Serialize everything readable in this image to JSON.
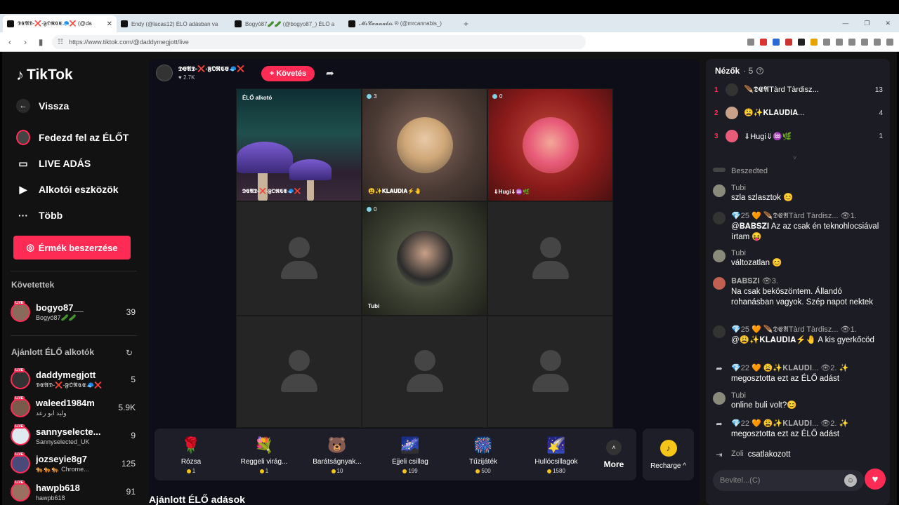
{
  "browser": {
    "tabs": [
      {
        "title": "𝕯𝕰𝕬𝕯-❌-𝕱𝕺𝕽𝕮𝕰🧢❌ (@da",
        "active": true
      },
      {
        "title": "Endy (@lacas12) ÉLŐ adásban va",
        "active": false
      },
      {
        "title": "Bogyó87🥒🥒 (@bogyo87_) ÉLŐ a",
        "active": false
      },
      {
        "title": "𝓜𝓻𝓒𝓪𝓷𝓷𝓪𝓫𝓲𝓼 ® (@mrcannabis_)",
        "active": false
      }
    ],
    "url": "https://www.tiktok.com/@daddymegjott/live"
  },
  "sidebar": {
    "logo": "TikTok",
    "back": "Vissza",
    "nav": [
      {
        "label": "Fedezd fel az ÉLŐT",
        "icon": "explore-live-icon"
      },
      {
        "label": "LIVE ADÁS",
        "icon": "camera-icon"
      },
      {
        "label": "Alkotói eszközök",
        "icon": "creator-tools-icon"
      },
      {
        "label": "Több",
        "icon": "more-dots-icon"
      }
    ],
    "buy_coins": "Érmék beszerzése",
    "following_title": "Követettek",
    "following": [
      {
        "name": "bogyo87__",
        "sub": "Bogyó87🥒🥒",
        "count": "39"
      }
    ],
    "recommended_title": "Ajánlott ÉLŐ alkotók",
    "recommended": [
      {
        "name": "daddymegjott",
        "sub": "𝕯𝕰𝕬𝕯-❌-𝕱𝕺𝕽𝕮𝕰🧢❌",
        "count": "5"
      },
      {
        "name": "waleed1984m",
        "sub": "وليد ابو رعد",
        "count": "5.9K"
      },
      {
        "name": "sannyselecte...",
        "sub": "Sannyselected_UK",
        "count": "9"
      },
      {
        "name": "jozseyie8g7",
        "sub": "🐅🐅🐅 Chrome...",
        "count": "125"
      },
      {
        "name": "hawpb618",
        "sub": "hawpb618",
        "count": "91"
      }
    ]
  },
  "stream": {
    "host_name": "𝕯𝕰𝕬𝕯-❌-𝕱𝕺𝕽𝕮𝕰🧢❌",
    "host_likes": "♥ 2.7K",
    "follow": "+ Követés",
    "cells": [
      {
        "label_top": "ÉLŐ alkotó",
        "label_bottom": "𝕯𝕰𝕬𝕯-❌-𝕱𝕺𝕽𝕮𝕰🧢❌"
      },
      {
        "badge": "3",
        "label_bottom": "😩✨𝐊𝐋𝐀𝐔𝐃𝐈𝐀⚡🤚"
      },
      {
        "badge": "0",
        "label_bottom": "⇓Hugi⇓♒🌿"
      },
      {
        "badge": "0",
        "label_bottom": "Tubi"
      }
    ],
    "gifts": [
      {
        "name": "Rózsa",
        "price": "1",
        "icon": "🌹"
      },
      {
        "name": "Reggeli virág...",
        "price": "1",
        "icon": "💐"
      },
      {
        "name": "Barátságnyak...",
        "price": "10",
        "icon": "🐻"
      },
      {
        "name": "Éjjeli csillag",
        "price": "199",
        "icon": "🌌"
      },
      {
        "name": "Tűzijáték",
        "price": "500",
        "icon": "🎆"
      },
      {
        "name": "Hullócsillagok",
        "price": "1580",
        "icon": "🌠"
      }
    ],
    "more": "More",
    "recharge": "Recharge ^",
    "recommended_live": "Ajánlott ÉLŐ adások"
  },
  "chat": {
    "viewers_label": "Nézők",
    "viewers_count": "· 5",
    "top_viewers": [
      {
        "rank": "1",
        "name": "🪶𝕯𝕰𝕬Tàrd Tàrdisz...",
        "score": "13"
      },
      {
        "rank": "2",
        "name": "😩✨𝐊𝐋𝐀𝐔𝐃𝐈𝐀...",
        "score": "4"
      },
      {
        "rank": "3",
        "name": "⇓Hugi⇓♒🌿",
        "score": "1"
      }
    ],
    "messages": [
      {
        "user": "Beszedted",
        "text": ""
      },
      {
        "user": "Tubi",
        "text": "szla szlasztok 😊"
      },
      {
        "user": "💎25 🧡 🪶𝕯𝕰𝕬Tàrd Tàrdisz... 👁1.",
        "text": "@𝐁𝐀𝐁𝐒𝐙𝐈 Az az csak én teknohlocsiával írtam 😝"
      },
      {
        "user": "Tubi",
        "text": "változatlan 😊"
      },
      {
        "user": "𝐁𝐀𝐁𝐒𝐙𝐈 👁3.",
        "text": "Na csak beköszöntem. Állandó rohanásban vagyok. Szép napot nektek"
      },
      {
        "user": "💎25 🧡 🪶𝕯𝕰𝕬Tàrd Tàrdisz... 👁1.",
        "text": "@😩✨𝐊𝐋𝐀𝐔𝐃𝐈𝐀⚡🤚 A kis gyerkőcöd"
      },
      {
        "user": "💎22 🧡 😩✨𝐊𝐋𝐀𝐔𝐃𝐈... 👁2. ✨",
        "text": "megosztotta ezt az ÉLŐ adást"
      },
      {
        "user": "Tubi",
        "text": "online buli volt?😊"
      },
      {
        "user": "💎22 🧡 😩✨𝐊𝐋𝐀𝐔𝐃𝐈... 👁2. ✨",
        "text": "megosztotta ezt az ÉLŐ adást"
      },
      {
        "user": "Zoli",
        "text": "csatlakozott"
      }
    ],
    "input_placeholder": "Bevitel...(C)"
  }
}
